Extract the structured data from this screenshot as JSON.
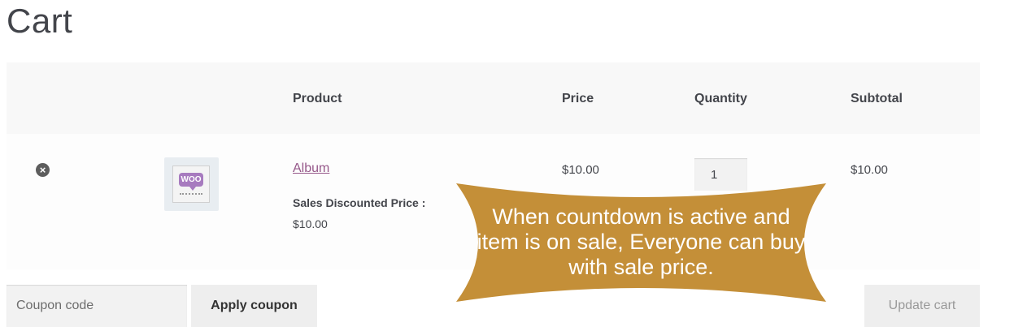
{
  "page": {
    "title": "Cart"
  },
  "table": {
    "headers": {
      "product": "Product",
      "price": "Price",
      "quantity": "Quantity",
      "subtotal": "Subtotal"
    },
    "rows": [
      {
        "remove_icon": "close-circle-icon",
        "thumbnail_badge": "WOO",
        "product": "Album",
        "meta_label": "Sales Discounted Price :",
        "meta_value": "$10.00",
        "price": "$10.00",
        "quantity": "1",
        "subtotal": "$10.00"
      }
    ]
  },
  "coupon": {
    "placeholder": "Coupon code",
    "value": "",
    "apply_label": "Apply coupon"
  },
  "update_label": "Update cart",
  "callout": {
    "text": "When countdown is active and item is on sale, Everyone can buy with sale price.",
    "color": "#c48f38"
  },
  "colors": {
    "link": "#96588a",
    "header_bg": "#f8f8f8",
    "text": "#43454b"
  }
}
